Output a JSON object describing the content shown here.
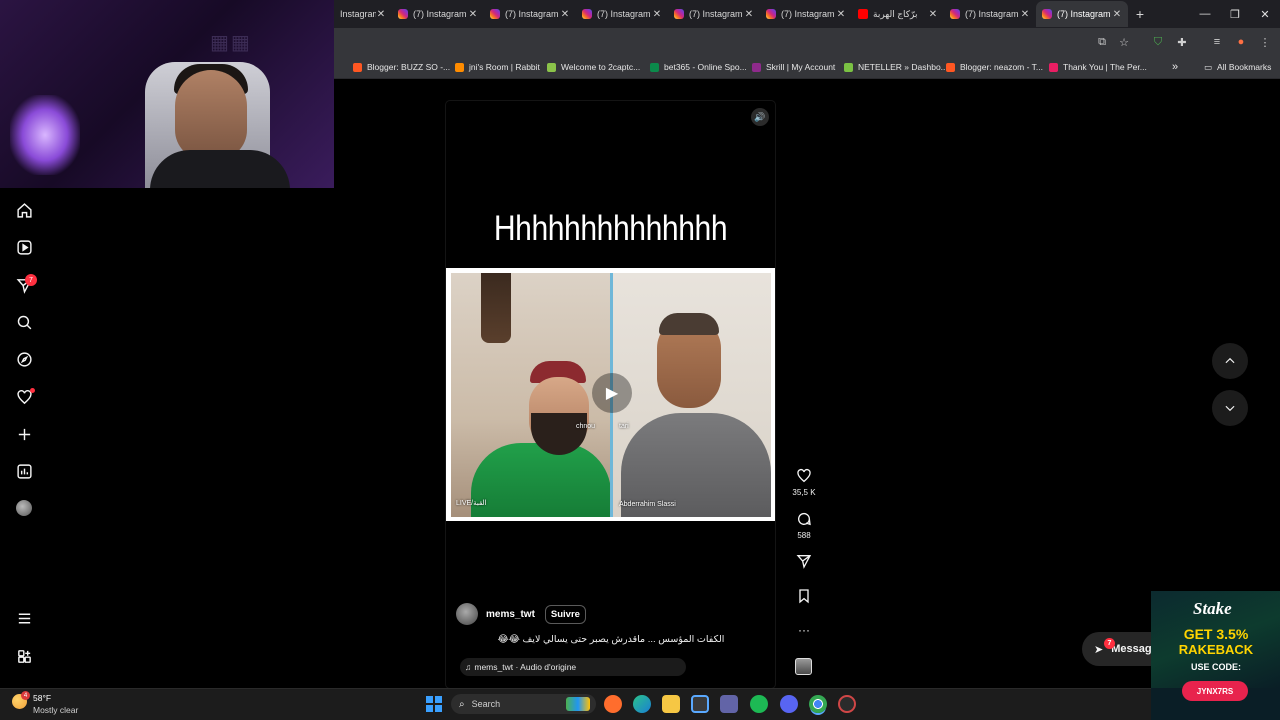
{
  "tabs": [
    {
      "label": "Instagram",
      "kind": "instagram"
    },
    {
      "label": "(7) Instagram",
      "kind": "instagram"
    },
    {
      "label": "(7) Instagram",
      "kind": "instagram"
    },
    {
      "label": "(7) Instagram",
      "kind": "instagram"
    },
    {
      "label": "(7) Instagram",
      "kind": "instagram"
    },
    {
      "label": "(7) Instagram",
      "kind": "instagram"
    },
    {
      "label": "برّكاج الهربة",
      "kind": "youtube"
    },
    {
      "label": "(7) Instagram",
      "kind": "instagram"
    },
    {
      "label": "(7) Instagram",
      "kind": "instagram",
      "active": true
    }
  ],
  "bookmarks": [
    {
      "label": "Blogger: BUZZ SO -...",
      "color": "#ff5722"
    },
    {
      "label": "jni's Room | Rabbit",
      "color": "#ff8c00"
    },
    {
      "label": "Welcome to 2captc...",
      "color": "#8bc34a"
    },
    {
      "label": "bet365 - Online Spo...",
      "color": "#0b8a4b"
    },
    {
      "label": "Skrill | My Account",
      "color": "#8e2a8b"
    },
    {
      "label": "NETELLER » Dashbo...",
      "color": "#7ac143"
    },
    {
      "label": "Blogger: neazom - T...",
      "color": "#ff5722"
    },
    {
      "label": "Thank You | The Per...",
      "color": "#e91e63"
    }
  ],
  "all_bookmarks_label": "All Bookmarks",
  "sidebar": {
    "notifications_badge": "7",
    "items": [
      "home-icon",
      "reels-icon",
      "direct-icon",
      "search-icon",
      "explore-icon",
      "heart-icon",
      "create-icon",
      "dashboard-icon",
      "profile-avatar",
      "menu-icon",
      "threads-icon"
    ]
  },
  "reel": {
    "overlay_text": "Hhhhhhhhhhhhhh",
    "clip_label_left": "chnou",
    "clip_label_right": "tari",
    "clip_watermark_left": "LIVE/القبة",
    "clip_watermark_right": "Abderrahim Slassi",
    "author": "mems_twt",
    "follow_label": "Suivre",
    "caption": "الكفات المؤسس ... ماقدرش يصبر حتى يسالي لايف 😂😂",
    "audio": "mems_twt · Audio d'origine",
    "likes": "35,5 K",
    "comments": "588"
  },
  "messages": {
    "label": "Messag",
    "badge": "7"
  },
  "ad": {
    "brand": "Stake",
    "line1": "GET 3.5%",
    "line2": "RAKEBACK",
    "line3": "USE CODE:",
    "code": "JYNX7RS"
  },
  "taskbar": {
    "temperature": "58°F",
    "condition": "Mostly clear",
    "weather_badge": "4",
    "search_placeholder": "Search"
  }
}
